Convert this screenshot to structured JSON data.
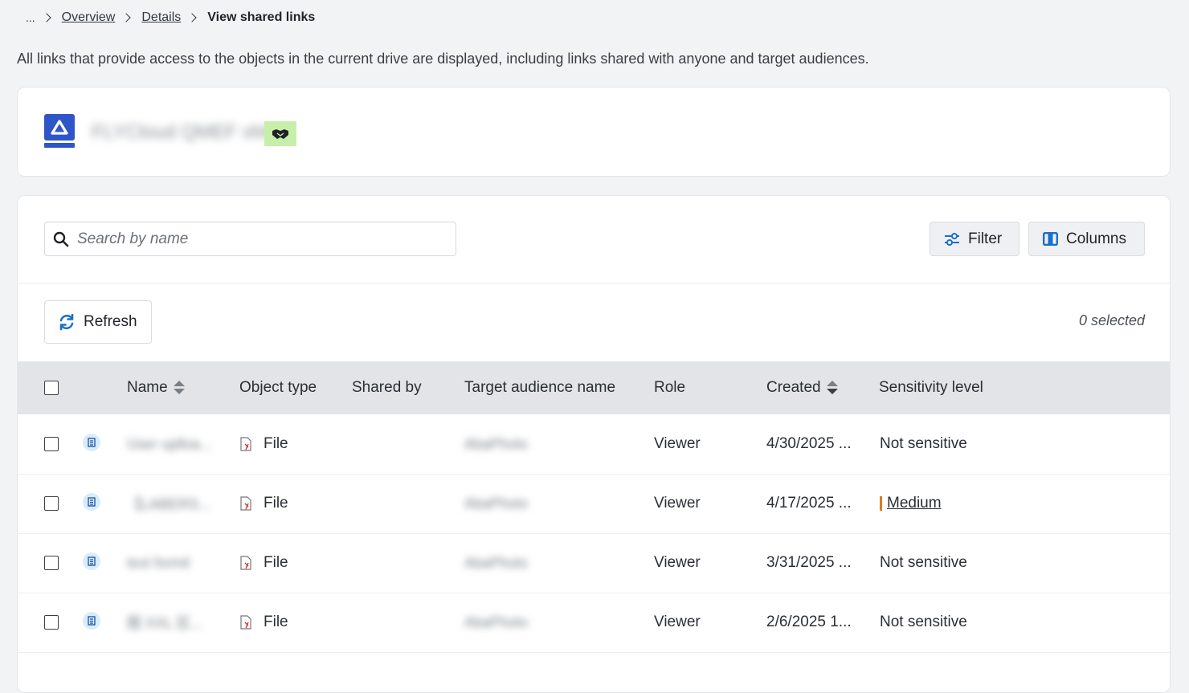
{
  "breadcrumb": {
    "ellipsis": "...",
    "items": [
      "Overview",
      "Details"
    ],
    "current": "View shared links"
  },
  "description": "All links that provide access to the objects in the current drive are displayed, including links shared with anyone and target audiences.",
  "drive": {
    "name": "FLYCloud QMEF xMen",
    "icon": "google-drive-icon",
    "badge_icon": "handshake-icon",
    "badge_color": "#c7efa9"
  },
  "toolbar": {
    "search_placeholder": "Search by name",
    "filter_label": "Filter",
    "columns_label": "Columns",
    "refresh_label": "Refresh",
    "selected_text": "0 selected"
  },
  "table": {
    "headers": {
      "name": "Name",
      "object_type": "Object type",
      "shared_by": "Shared by",
      "target_audience": "Target audience name",
      "role": "Role",
      "created": "Created",
      "sensitivity": "Sensitivity level"
    },
    "rows": [
      {
        "name": "User uplloa...",
        "type": "File",
        "shared_by": "",
        "audience": "AbaPhoto",
        "role": "Viewer",
        "created": "4/30/2025 ...",
        "sensitivity": "Not sensitive"
      },
      {
        "name": "【LABERS...",
        "type": "File",
        "shared_by": "",
        "audience": "AbaPhoto",
        "role": "Viewer",
        "created": "4/17/2025 ...",
        "sensitivity": "Medium"
      },
      {
        "name": "text formil",
        "type": "File",
        "shared_by": "",
        "audience": "AbaPhoto",
        "role": "Viewer",
        "created": "3/31/2025 ...",
        "sensitivity": "Not sensitive"
      },
      {
        "name": "图 XXL 区...",
        "type": "File",
        "shared_by": "",
        "audience": "AbaPhoto",
        "role": "Viewer",
        "created": "2/6/2025 1...",
        "sensitivity": "Not sensitive"
      }
    ]
  },
  "colors": {
    "accent": "#1a6fce",
    "medium_flag": "#e07a1f",
    "header_bg": "#e2e4e7"
  }
}
